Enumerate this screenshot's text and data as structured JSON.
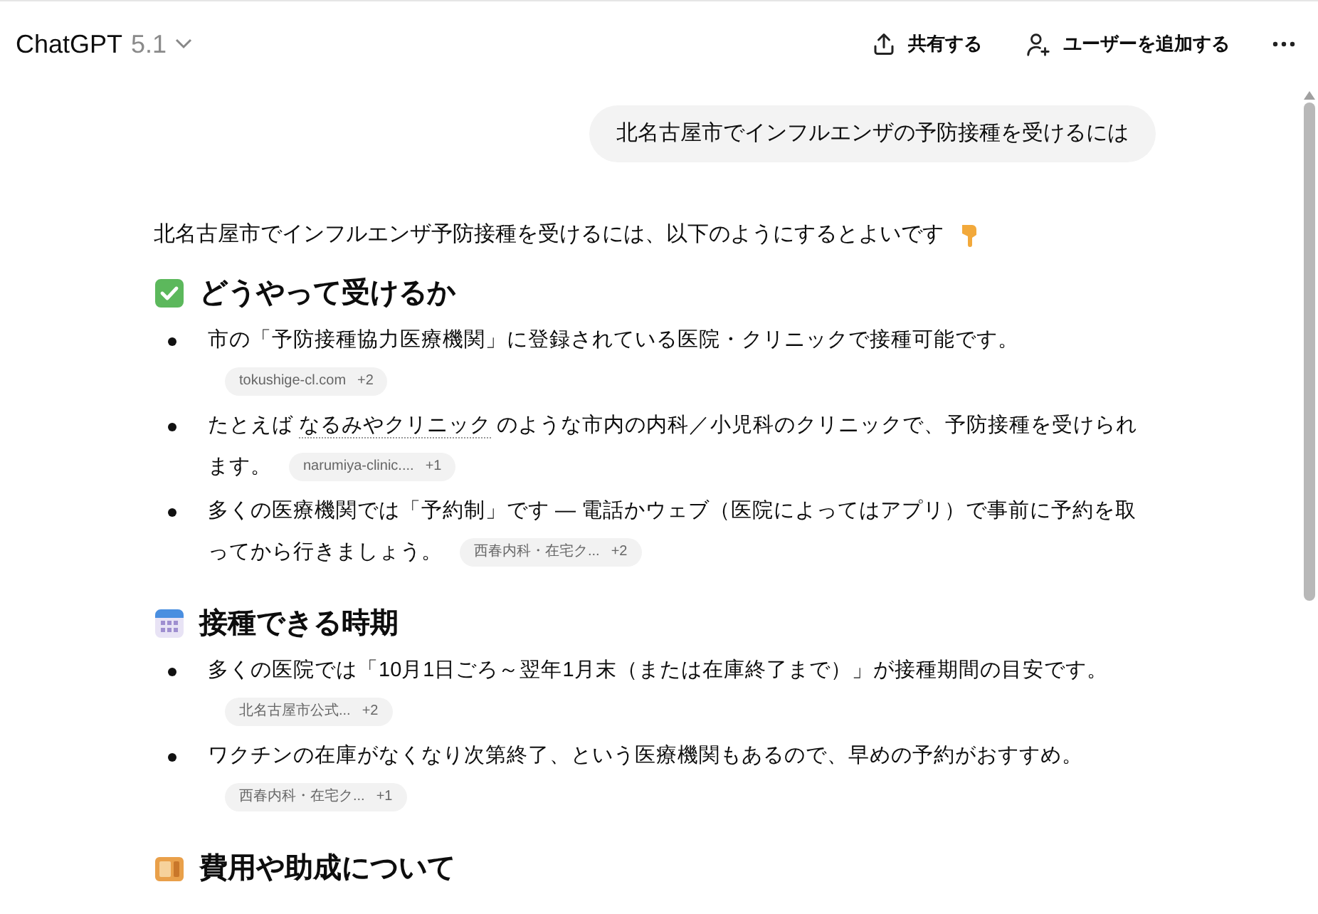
{
  "header": {
    "title": "ChatGPT",
    "version": "5.1",
    "actions": [
      {
        "kind": "share",
        "label": "共有する"
      },
      {
        "kind": "add_user",
        "label": "ユーザーを追加する"
      }
    ]
  },
  "user_message": "北名古屋市でインフルエンザの予防接種を受けるには",
  "answer": {
    "intro": "北名古屋市でインフルエンザ予防接種を受けるには、以下のようにするとよいです",
    "sections": [
      {
        "heading": "どうやって受けるか",
        "items": [
          {
            "parts": [
              {
                "kind": "text",
                "text": "市の「予防接種協力医療機関」に登録されている医院・クリニックで接種可能です。"
              }
            ],
            "citation": {
              "source": "tokushige-cl.com",
              "count": "+2"
            }
          },
          {
            "parts": [
              {
                "kind": "text",
                "text": "たとえば "
              },
              {
                "kind": "link",
                "text": "なるみやクリニック"
              },
              {
                "kind": "text",
                "text": " のような市内の内科／小児科のクリニックで、予防接種を受けられます。"
              }
            ],
            "citation": {
              "source": "narumiya-clinic....",
              "count": "+1"
            }
          },
          {
            "parts": [
              {
                "kind": "text",
                "text": "多くの医療機関では「予約制」です — 電話かウェブ（医院によってはアプリ）で事前に予約を取ってから行きましょう。"
              }
            ],
            "citation": {
              "source": "西春内科・在宅ク...",
              "count": "+2"
            }
          }
        ]
      },
      {
        "heading": "接種できる時期",
        "items": [
          {
            "parts": [
              {
                "kind": "text",
                "text": "多くの医院では「10月1日ごろ～翌年1月末（または在庫終了まで）」が接種期間の目安です。"
              }
            ],
            "citation": {
              "source": "北名古屋市公式...",
              "count": "+2"
            }
          },
          {
            "parts": [
              {
                "kind": "text",
                "text": "ワクチンの在庫がなくなり次第終了、という医療機関もあるので、早めの予約がおすすめ。"
              }
            ],
            "citation": {
              "source": "西春内科・在宅ク...",
              "count": "+1"
            }
          }
        ]
      },
      {
        "heading": "費用や助成について"
      }
    ]
  }
}
